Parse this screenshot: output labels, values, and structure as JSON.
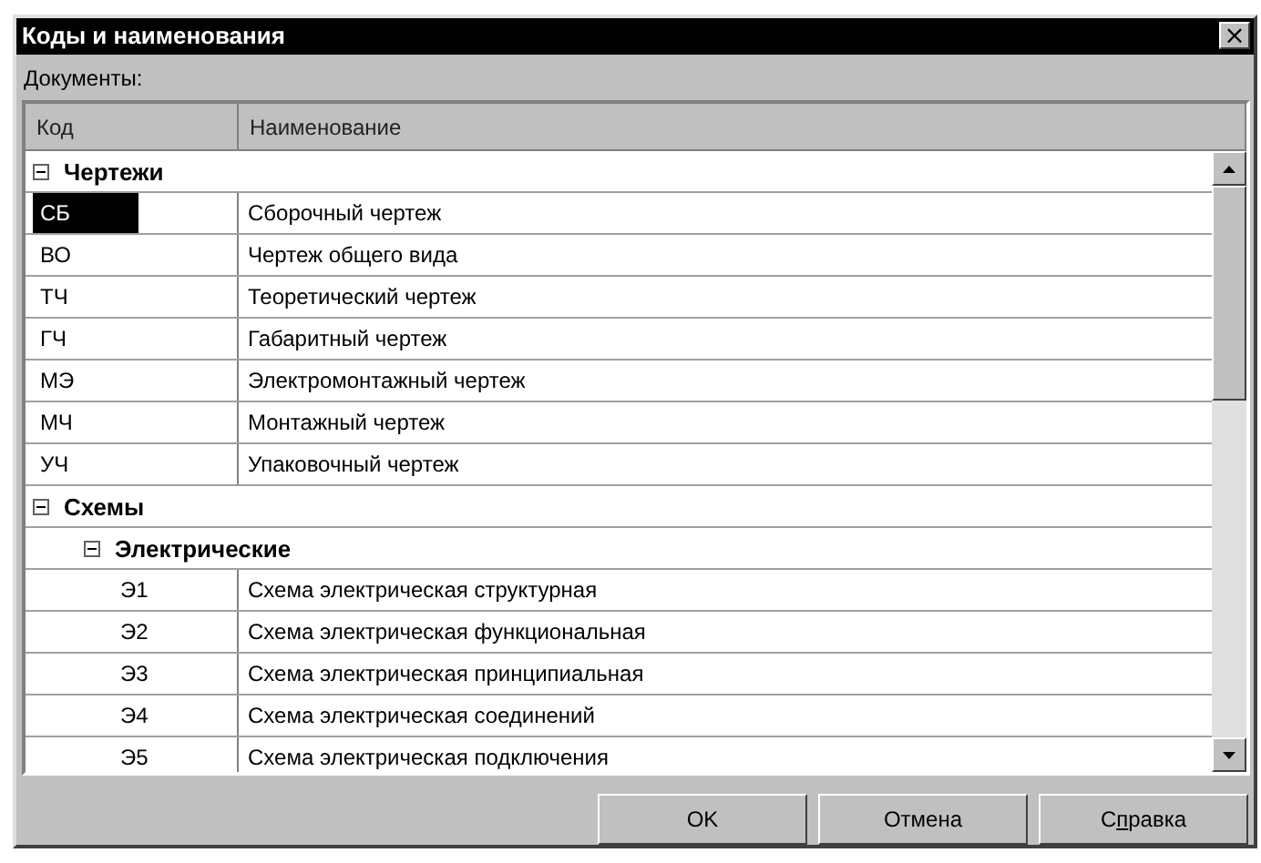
{
  "window": {
    "title": "Коды и наименования",
    "close": "×"
  },
  "list_label": "Документы:",
  "table": {
    "columns": [
      "Код",
      "Наименование"
    ],
    "rows": [
      {
        "kind": "group",
        "label": "Чертежи",
        "expanded": true,
        "children": [
          {
            "kind": "item",
            "code": "СБ",
            "name": "Сборочный чертеж",
            "selected": true
          },
          {
            "kind": "item",
            "code": "ВО",
            "name": "Чертеж общего вида",
            "selected": false
          },
          {
            "kind": "item",
            "code": "ТЧ",
            "name": "Теоретический чертеж",
            "selected": false
          },
          {
            "kind": "item",
            "code": "ГЧ",
            "name": "Габаритный чертеж",
            "selected": false
          },
          {
            "kind": "item",
            "code": "МЭ",
            "name": "Электромонтажный чертеж",
            "selected": false
          },
          {
            "kind": "item",
            "code": "МЧ",
            "name": "Монтажный чертеж",
            "selected": false
          },
          {
            "kind": "item",
            "code": "УЧ",
            "name": "Упаковочный чертеж",
            "selected": false
          }
        ]
      },
      {
        "kind": "group",
        "label": "Схемы",
        "expanded": true,
        "children": [
          {
            "kind": "group",
            "label": "Электрические",
            "expanded": true,
            "children": [
              {
                "kind": "item",
                "code": "Э1",
                "name": "Схема электрическая структурная",
                "selected": false
              },
              {
                "kind": "item",
                "code": "Э2",
                "name": "Схема электрическая функциональная",
                "selected": false
              },
              {
                "kind": "item",
                "code": "Э3",
                "name": "Схема электрическая принципиальная",
                "selected": false
              },
              {
                "kind": "item",
                "code": "Э4",
                "name": "Схема электрическая соединений",
                "selected": false
              },
              {
                "kind": "item",
                "code": "Э5",
                "name": "Схема электрическая подключения",
                "selected": false
              }
            ]
          }
        ]
      }
    ]
  },
  "buttons": [
    {
      "label": "OK"
    },
    {
      "label": "Отмена"
    },
    {
      "label": "С",
      "mnemonic": "п",
      "label_rest": "равка"
    }
  ]
}
